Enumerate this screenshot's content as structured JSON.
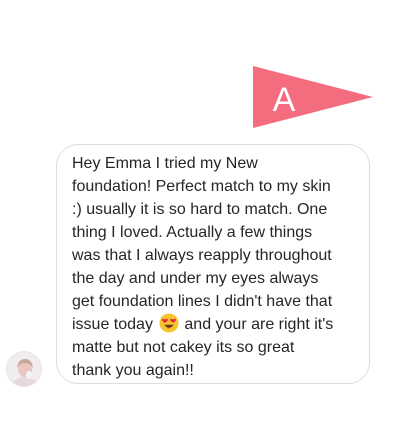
{
  "conversation": {
    "sent_sticker": {
      "type": "pennant",
      "letter": "A",
      "color": "#f46d7f"
    },
    "received_message": {
      "lines": [
        "Hey Emma I tried my New",
        "foundation! Perfect match to my skin",
        ":) usually it is so hard to match. One",
        "thing I loved. Actually a few things",
        "was that I always reapply throughout",
        "the day and under my eyes always",
        "get foundation lines I didn't have that",
        "matte but not cakey its so great",
        "thank you again!!"
      ],
      "emoji_line_before": "issue today",
      "emoji_line_after": "and your are right it's",
      "emoji": "heart-eyes-emoji"
    },
    "sender": {
      "avatar": "profile-photo"
    }
  }
}
